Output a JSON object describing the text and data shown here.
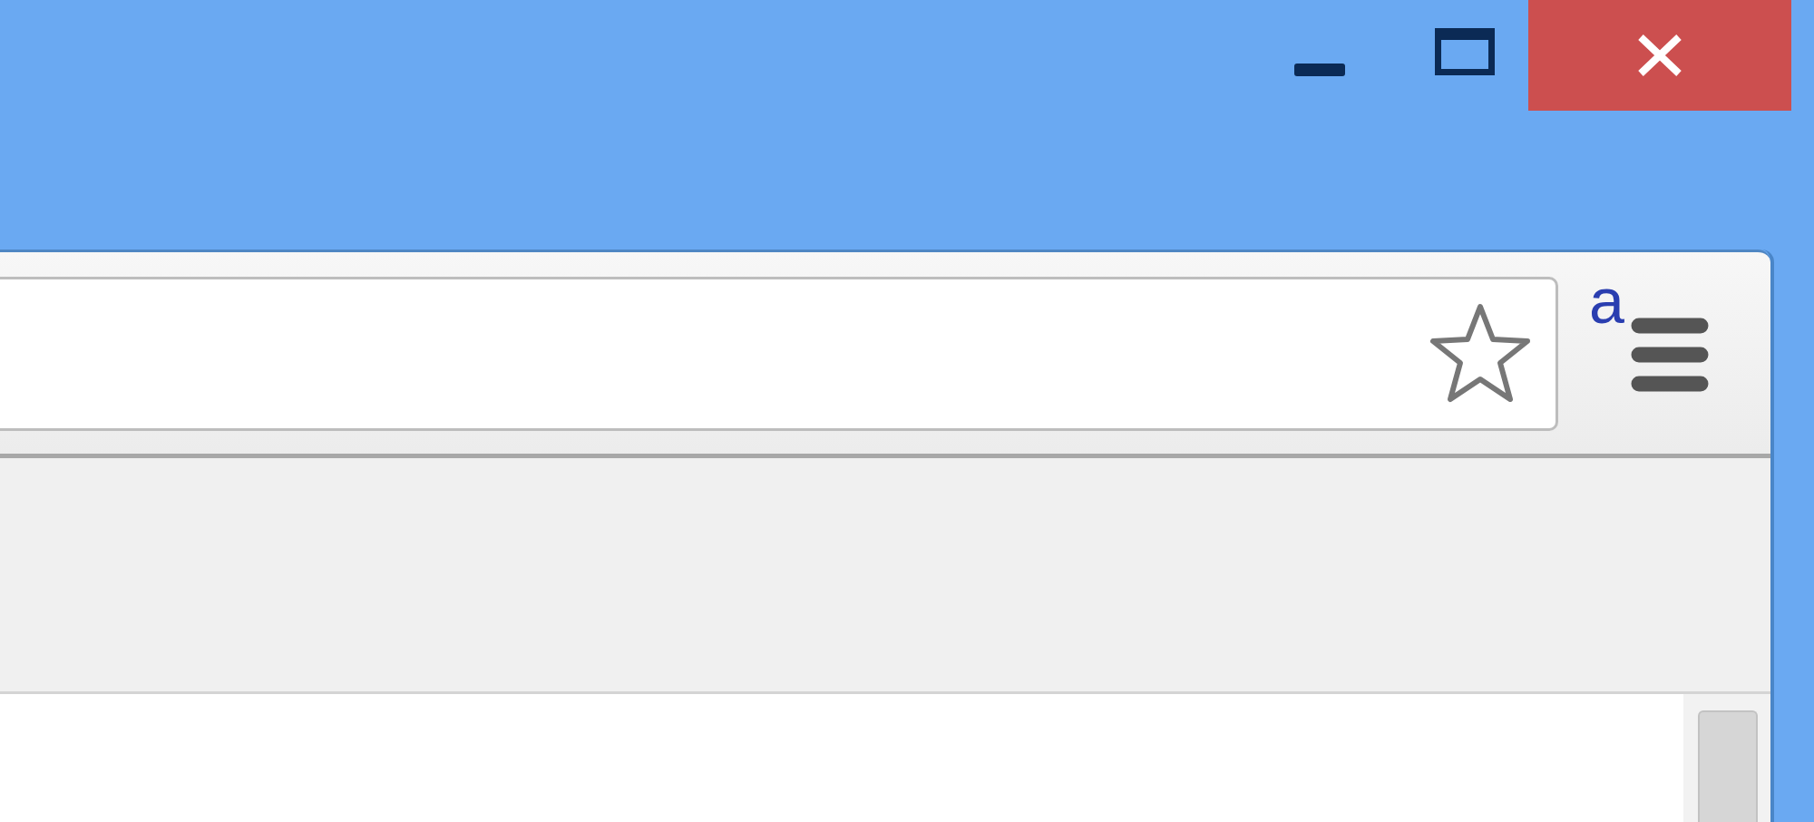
{
  "toolbar": {
    "extension_badge": "a"
  }
}
